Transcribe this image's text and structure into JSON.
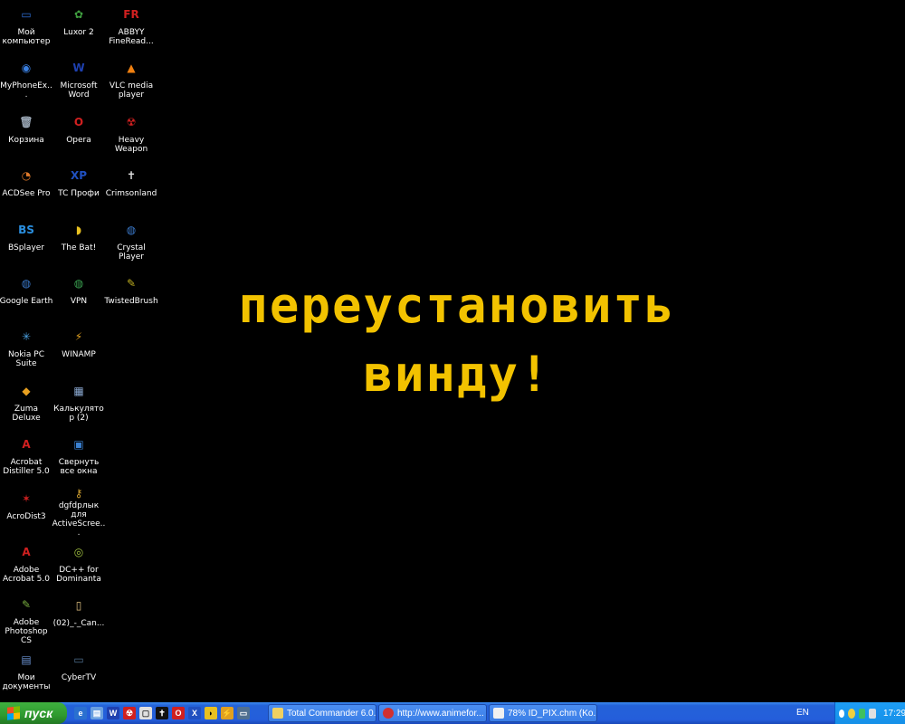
{
  "desktop": {
    "message_line1": "переустановить",
    "message_line2": "винду!",
    "col1": [
      {
        "label": "Мой компьютер",
        "icon": "my-computer-icon",
        "glyph": "▭",
        "color": "#2f6fd6"
      },
      {
        "label": "MyPhoneEx...",
        "icon": "webcam-icon",
        "glyph": "◉",
        "color": "#3a7fe0"
      },
      {
        "label": "Корзина",
        "icon": "recycle-bin-icon",
        "glyph": "🗑",
        "color": "#9aa7b5"
      },
      {
        "label": "ACDSee Pro",
        "icon": "acdsee-icon",
        "glyph": "◔",
        "color": "#e07a2a"
      },
      {
        "label": "BSplayer",
        "icon": "bsplayer-icon",
        "glyph": "BS",
        "color": "#2a8fe0"
      },
      {
        "label": "Google Earth",
        "icon": "google-earth-icon",
        "glyph": "◍",
        "color": "#3a78c8"
      },
      {
        "label": "Nokia PC Suite",
        "icon": "nokia-icon",
        "glyph": "✳",
        "color": "#4aa0e0"
      },
      {
        "label": "Zuma Deluxe",
        "icon": "zuma-icon",
        "glyph": "◆",
        "color": "#e8a020"
      },
      {
        "label": "Acrobat Distiller 5.0",
        "icon": "acrobat-distiller-icon",
        "glyph": "A",
        "color": "#d02020"
      },
      {
        "label": "AcroDist3",
        "icon": "acrodist-icon",
        "glyph": "✶",
        "color": "#d02020"
      },
      {
        "label": "Adobe Acrobat 5.0",
        "icon": "adobe-acrobat-icon",
        "glyph": "A",
        "color": "#d02020"
      },
      {
        "label": "Adobe Photoshop CS",
        "icon": "photoshop-icon",
        "glyph": "✎",
        "color": "#7ab040"
      },
      {
        "label": "Мои документы",
        "icon": "my-documents-icon",
        "glyph": "▤",
        "color": "#6a90d0"
      }
    ],
    "col2": [
      {
        "label": "Luxor 2",
        "icon": "luxor-icon",
        "glyph": "✿",
        "color": "#40a040"
      },
      {
        "label": "Microsoft Word",
        "icon": "word-icon",
        "glyph": "W",
        "color": "#1e40b0"
      },
      {
        "label": "Opera",
        "icon": "opera-icon",
        "glyph": "O",
        "color": "#d02020"
      },
      {
        "label": "TC Профи",
        "icon": "tc-profi-icon",
        "glyph": "XP",
        "color": "#2050c0"
      },
      {
        "label": "The Bat!",
        "icon": "the-bat-icon",
        "glyph": "◗",
        "color": "#e8c020"
      },
      {
        "label": "VPN",
        "icon": "vpn-icon",
        "glyph": "◍",
        "color": "#3aa050"
      },
      {
        "label": "WINAMP",
        "icon": "winamp-icon",
        "glyph": "⚡",
        "color": "#e0a020"
      },
      {
        "label": "Калькулятор (2)",
        "icon": "calculator-icon",
        "glyph": "▦",
        "color": "#8aa8d0"
      },
      {
        "label": "Свернуть все окна",
        "icon": "minimize-all-icon",
        "glyph": "▣",
        "color": "#3a80d0"
      },
      {
        "label": "dgfdрлык для ActiveScree...",
        "icon": "keys-icon",
        "glyph": "⚷",
        "color": "#d0a030"
      },
      {
        "label": "DC++ for Dominanta",
        "icon": "dcpp-icon",
        "glyph": "◎",
        "color": "#a0c040"
      },
      {
        "label": "(02)_-_Can...",
        "icon": "file-icon",
        "glyph": "▯",
        "color": "#e0c080"
      },
      {
        "label": "CyberTV",
        "icon": "tv-icon",
        "glyph": "▭",
        "color": "#507090"
      }
    ],
    "col3": [
      {
        "label": "ABBYY FineRead...",
        "icon": "abbyy-icon",
        "glyph": "FR",
        "color": "#d02020"
      },
      {
        "label": "VLC media player",
        "icon": "vlc-icon",
        "glyph": "▲",
        "color": "#f08010"
      },
      {
        "label": "Heavy Weapon",
        "icon": "heavy-weapon-icon",
        "glyph": "☢",
        "color": "#d02020"
      },
      {
        "label": "Crimsonland",
        "icon": "crimsonland-icon",
        "glyph": "✝",
        "color": "#e0e0e0"
      },
      {
        "label": "Crystal Player",
        "icon": "crystal-player-icon",
        "glyph": "◍",
        "color": "#3a78c8"
      },
      {
        "label": "TwistedBrush",
        "icon": "twistedbrush-icon",
        "glyph": "✎",
        "color": "#c0b020"
      }
    ]
  },
  "taskbar": {
    "start_label": "пуск",
    "tasks": [
      {
        "label": "Total Commander 6.0...",
        "icon": "total-commander-icon",
        "color": "#f0d060"
      },
      {
        "label": "http://www.animefor...",
        "icon": "opera-icon",
        "color": "#d03030"
      },
      {
        "label": "78% ID_PIX.chm (Ko...",
        "icon": "download-icon",
        "color": "#f0f0f0"
      }
    ],
    "language": "EN",
    "clock": "17:29"
  }
}
